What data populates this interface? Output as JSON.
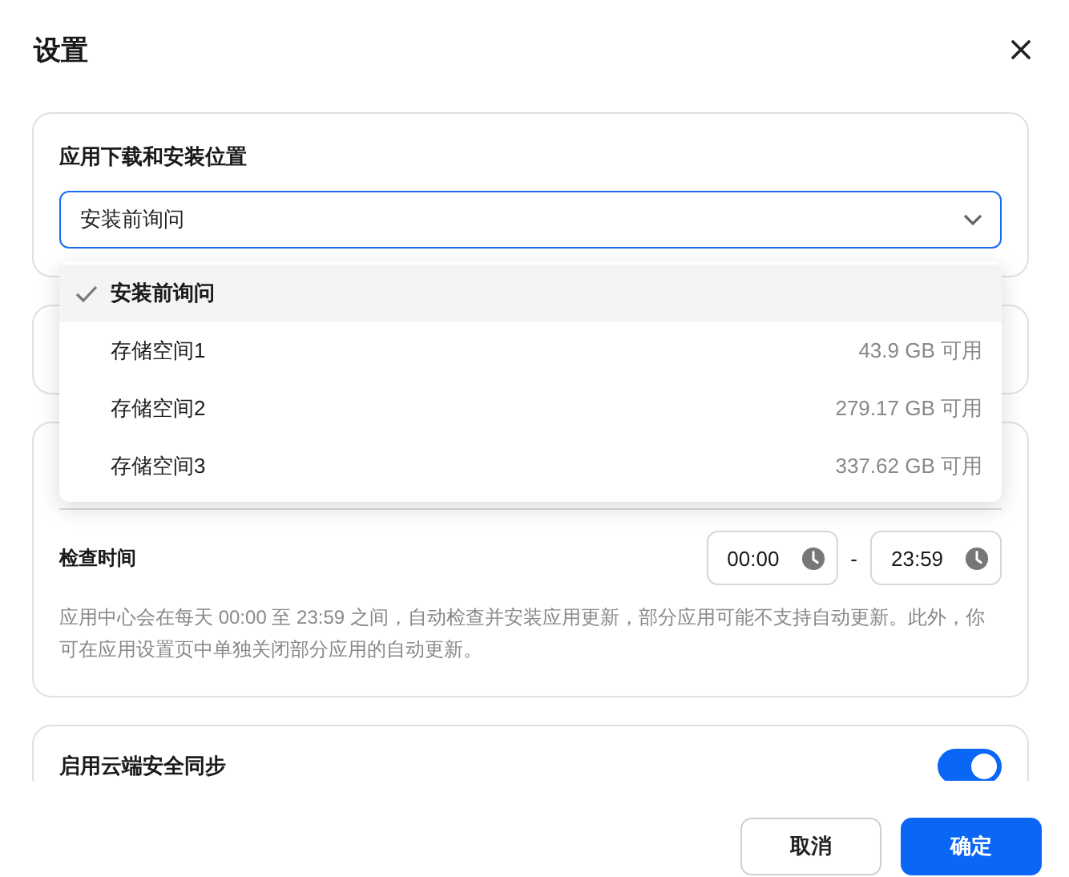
{
  "dialog": {
    "title": "设置"
  },
  "location": {
    "title": "应用下载和安装位置",
    "value": "安装前询问",
    "expanded": true,
    "options": [
      {
        "label": "安装前询问",
        "selected": true
      },
      {
        "label": "存储空间1",
        "detail": "43.9 GB 可用",
        "selected": false
      },
      {
        "label": "存储空间2",
        "detail": "279.17 GB 可用",
        "selected": false
      },
      {
        "label": "存储空间3",
        "detail": "337.62 GB 可用",
        "selected": false
      }
    ]
  },
  "update": {
    "time_label": "检查时间",
    "start": "00:00",
    "separator": "-",
    "end": "23:59",
    "description": "应用中心会在每天 00:00 至 23:59 之间，自动检查并安装应用更新，部分应用可能不支持自动更新。此外，你可在应用设置页中单独关闭部分应用的自动更新。"
  },
  "cloud_sync": {
    "title": "启用云端安全同步",
    "on": true
  },
  "buttons": [
    {
      "label": "取消",
      "kind": "secondary"
    },
    {
      "label": "确定",
      "kind": "primary"
    }
  ]
}
